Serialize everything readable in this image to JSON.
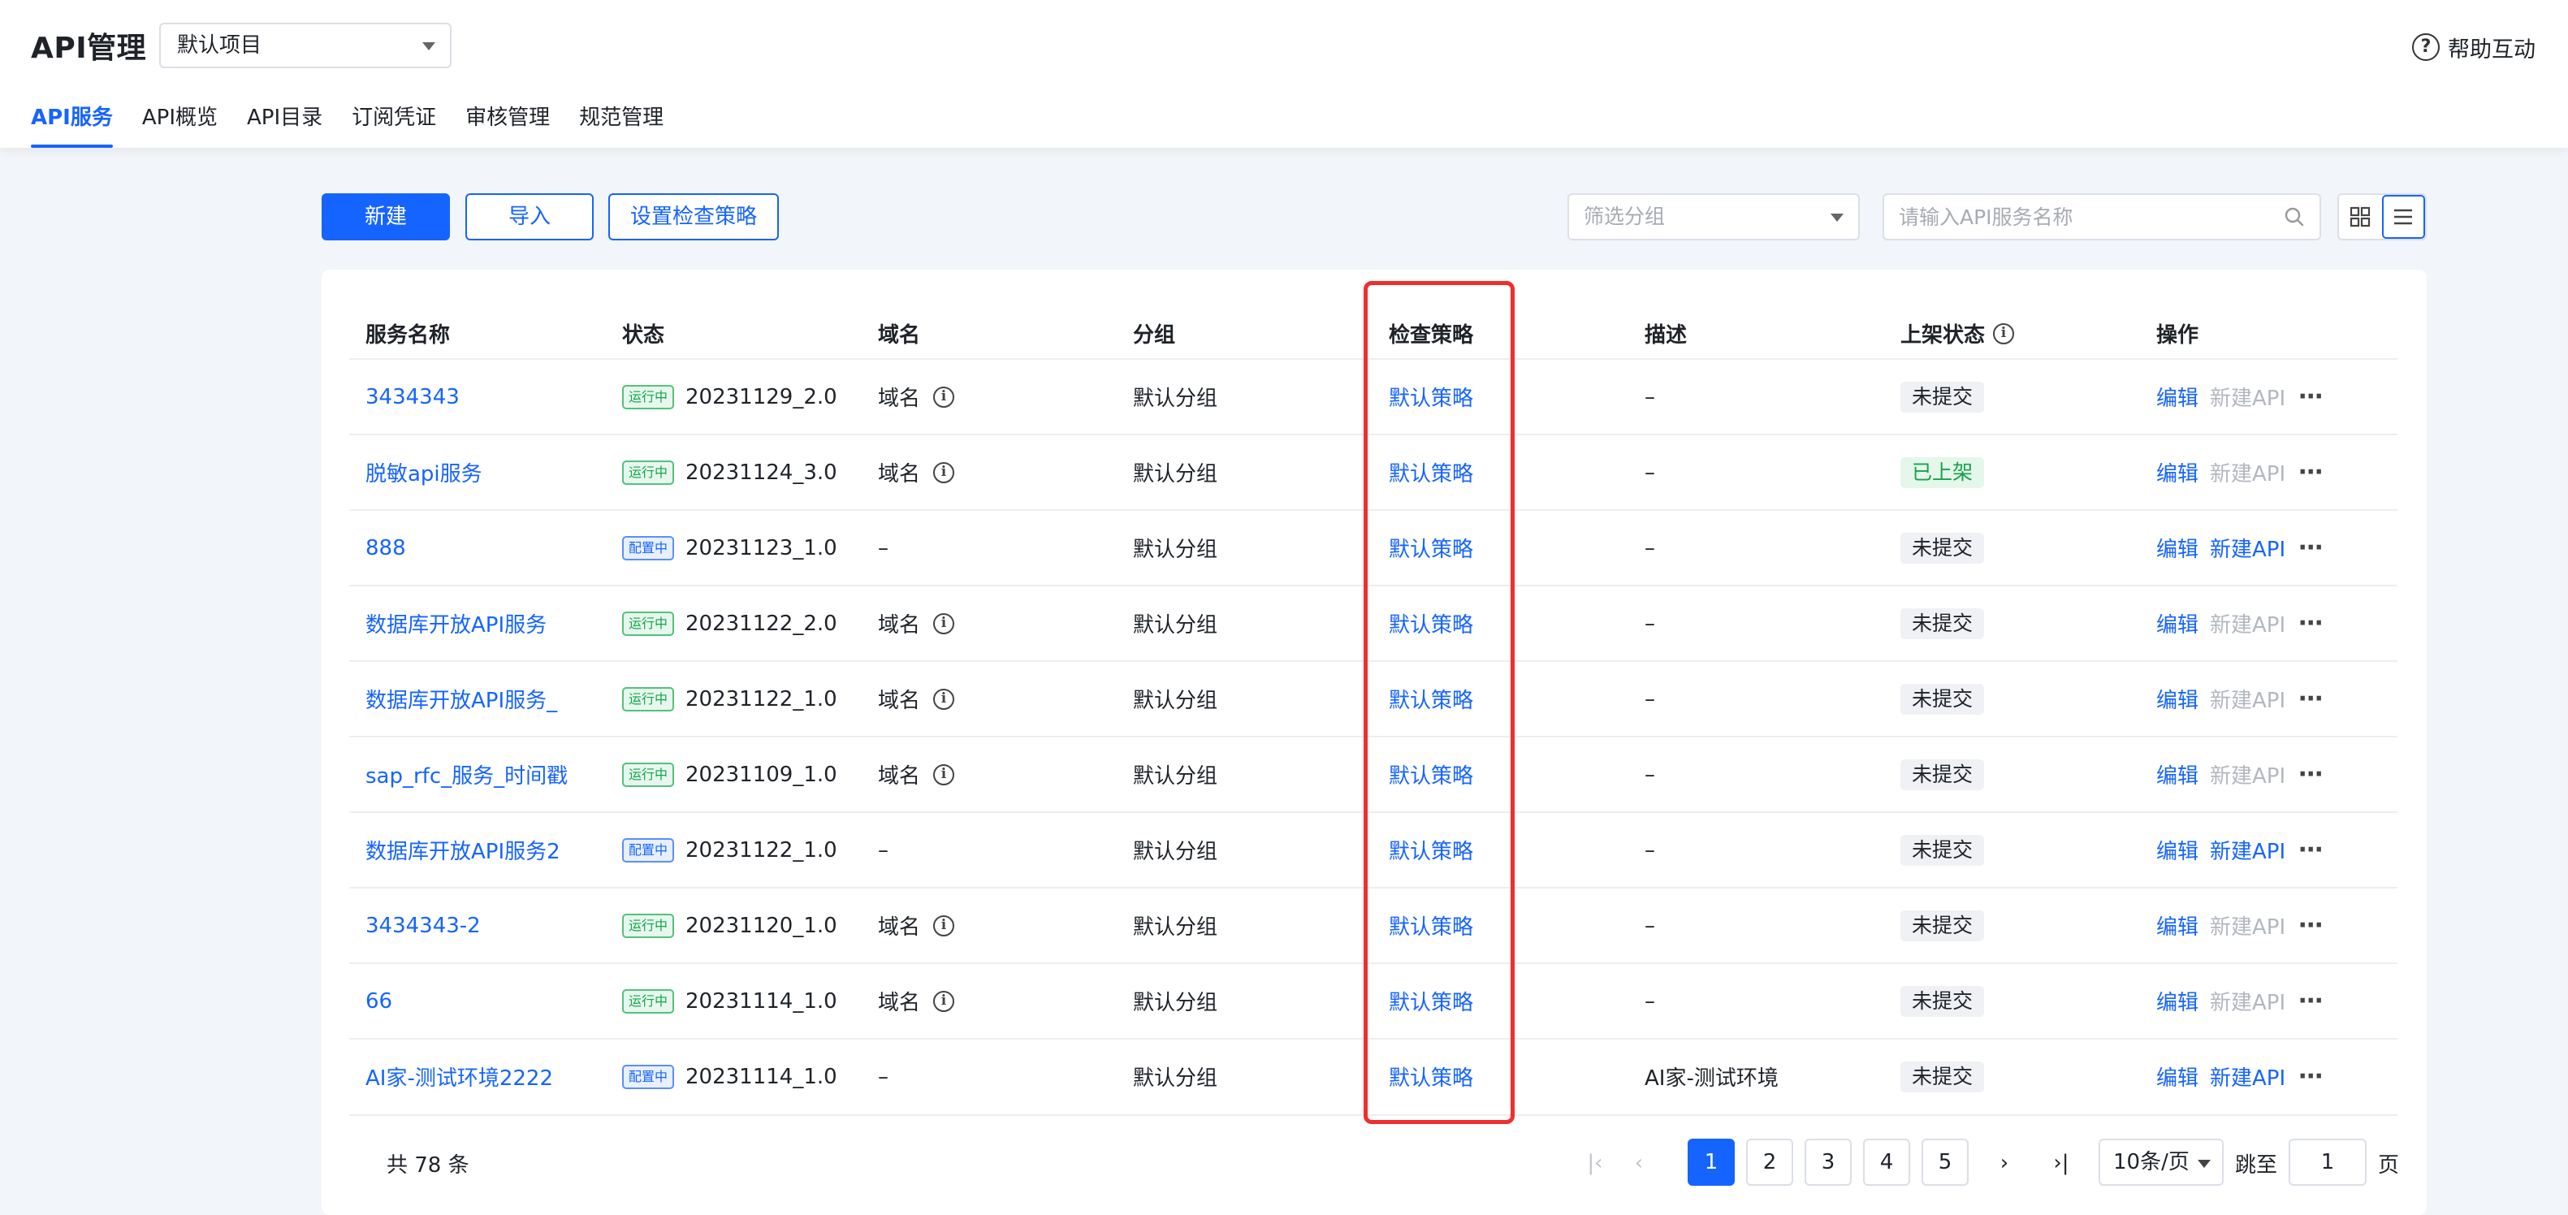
{
  "header": {
    "title": "API管理",
    "project": "默认项目",
    "help": "帮助互动",
    "tabs": [
      "API服务",
      "API概览",
      "API目录",
      "订阅凭证",
      "审核管理",
      "规范管理"
    ],
    "active_tab": 0
  },
  "toolbar": {
    "new_label": "新建",
    "import_label": "导入",
    "policy_label": "设置检查策略",
    "group_placeholder": "筛选分组",
    "search_placeholder": "请输入API服务名称"
  },
  "table": {
    "columns": [
      "服务名称",
      "状态",
      "域名",
      "分组",
      "检查策略",
      "描述",
      "上架状态",
      "操作"
    ],
    "edit_label": "编辑",
    "new_api_label": "新建API",
    "rows": [
      {
        "name": "3434343",
        "status": "运行中",
        "status_type": "run",
        "version": "20231129_2.0",
        "domain": "域名",
        "has_domain": true,
        "group": "默认分组",
        "policy": "默认策略",
        "desc": "–",
        "shelf": "未提交",
        "shelf_type": "none",
        "new_enabled": false
      },
      {
        "name": "脱敏api服务",
        "status": "运行中",
        "status_type": "run",
        "version": "20231124_3.0",
        "domain": "域名",
        "has_domain": true,
        "group": "默认分组",
        "policy": "默认策略",
        "desc": "–",
        "shelf": "已上架",
        "shelf_type": "up",
        "new_enabled": false
      },
      {
        "name": "888",
        "status": "配置中",
        "status_type": "cfg",
        "version": "20231123_1.0",
        "domain": "–",
        "has_domain": false,
        "group": "默认分组",
        "policy": "默认策略",
        "desc": "–",
        "shelf": "未提交",
        "shelf_type": "none",
        "new_enabled": true
      },
      {
        "name": "数据库开放API服务",
        "status": "运行中",
        "status_type": "run",
        "version": "20231122_2.0",
        "domain": "域名",
        "has_domain": true,
        "group": "默认分组",
        "policy": "默认策略",
        "desc": "–",
        "shelf": "未提交",
        "shelf_type": "none",
        "new_enabled": false
      },
      {
        "name": "数据库开放API服务_",
        "status": "运行中",
        "status_type": "run",
        "version": "20231122_1.0",
        "domain": "域名",
        "has_domain": true,
        "group": "默认分组",
        "policy": "默认策略",
        "desc": "–",
        "shelf": "未提交",
        "shelf_type": "none",
        "new_enabled": false
      },
      {
        "name": "sap_rfc_服务_时间戳",
        "status": "运行中",
        "status_type": "run",
        "version": "20231109_1.0",
        "domain": "域名",
        "has_domain": true,
        "group": "默认分组",
        "policy": "默认策略",
        "desc": "–",
        "shelf": "未提交",
        "shelf_type": "none",
        "new_enabled": false
      },
      {
        "name": "数据库开放API服务2",
        "status": "配置中",
        "status_type": "cfg",
        "version": "20231122_1.0",
        "domain": "–",
        "has_domain": false,
        "group": "默认分组",
        "policy": "默认策略",
        "desc": "–",
        "shelf": "未提交",
        "shelf_type": "none",
        "new_enabled": true
      },
      {
        "name": "3434343-2",
        "status": "运行中",
        "status_type": "run",
        "version": "20231120_1.0",
        "domain": "域名",
        "has_domain": true,
        "group": "默认分组",
        "policy": "默认策略",
        "desc": "–",
        "shelf": "未提交",
        "shelf_type": "none",
        "new_enabled": false
      },
      {
        "name": "66",
        "status": "运行中",
        "status_type": "run",
        "version": "20231114_1.0",
        "domain": "域名",
        "has_domain": true,
        "group": "默认分组",
        "policy": "默认策略",
        "desc": "–",
        "shelf": "未提交",
        "shelf_type": "none",
        "new_enabled": false
      },
      {
        "name": "AI家-测试环境2222",
        "status": "配置中",
        "status_type": "cfg",
        "version": "20231114_1.0",
        "domain": "–",
        "has_domain": false,
        "group": "默认分组",
        "policy": "默认策略",
        "desc": "AI家-测试环境",
        "shelf": "未提交",
        "shelf_type": "none",
        "new_enabled": true
      }
    ]
  },
  "pagination": {
    "total": "共 78 条",
    "pages": [
      "1",
      "2",
      "3",
      "4",
      "5"
    ],
    "current": "1",
    "page_size": "10条/页",
    "jump_label": "跳至",
    "jump_value": "1",
    "page_label": "页"
  },
  "colors": {
    "accent": "#1664ff",
    "highlight": "#f02e2e",
    "running": "#11a84a",
    "listed": "#16a34a"
  }
}
